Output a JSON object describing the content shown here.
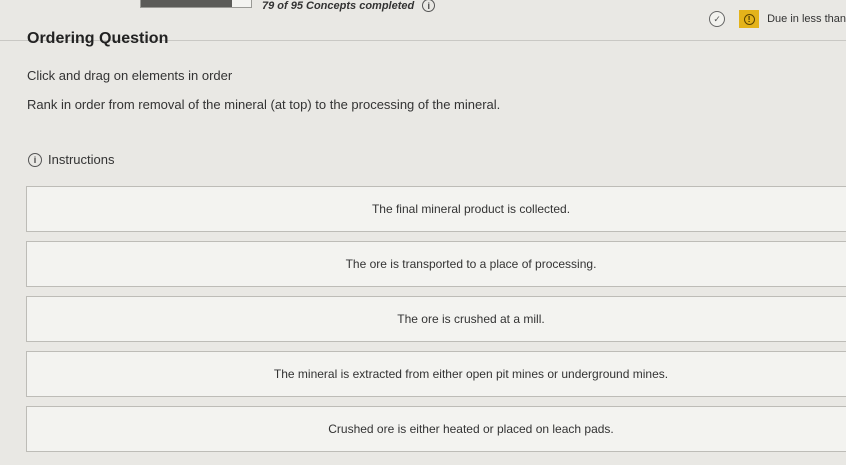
{
  "header": {
    "progress_fraction": 0.83,
    "concepts_text": "79 of 95 Concepts completed",
    "due_text": "Due in less than"
  },
  "question": {
    "title": "Ordering Question",
    "instruction": "Click and drag on elements in order",
    "prompt": "Rank in order from removal of the mineral (at top) to the processing of the mineral.",
    "instructions_link": "Instructions"
  },
  "items": [
    {
      "text": "The final mineral product is collected."
    },
    {
      "text": "The ore is transported to a place of processing."
    },
    {
      "text": "The ore is crushed at a mill."
    },
    {
      "text": "The mineral is extracted from either open pit mines or underground mines."
    },
    {
      "text": "Crushed ore is either heated or placed on leach pads."
    }
  ],
  "colors": {
    "alert": "#e4b31a",
    "background": "#e9e8e4"
  },
  "icons": {
    "info": "info-icon",
    "check": "check-circle-icon",
    "alert": "alert-icon"
  }
}
